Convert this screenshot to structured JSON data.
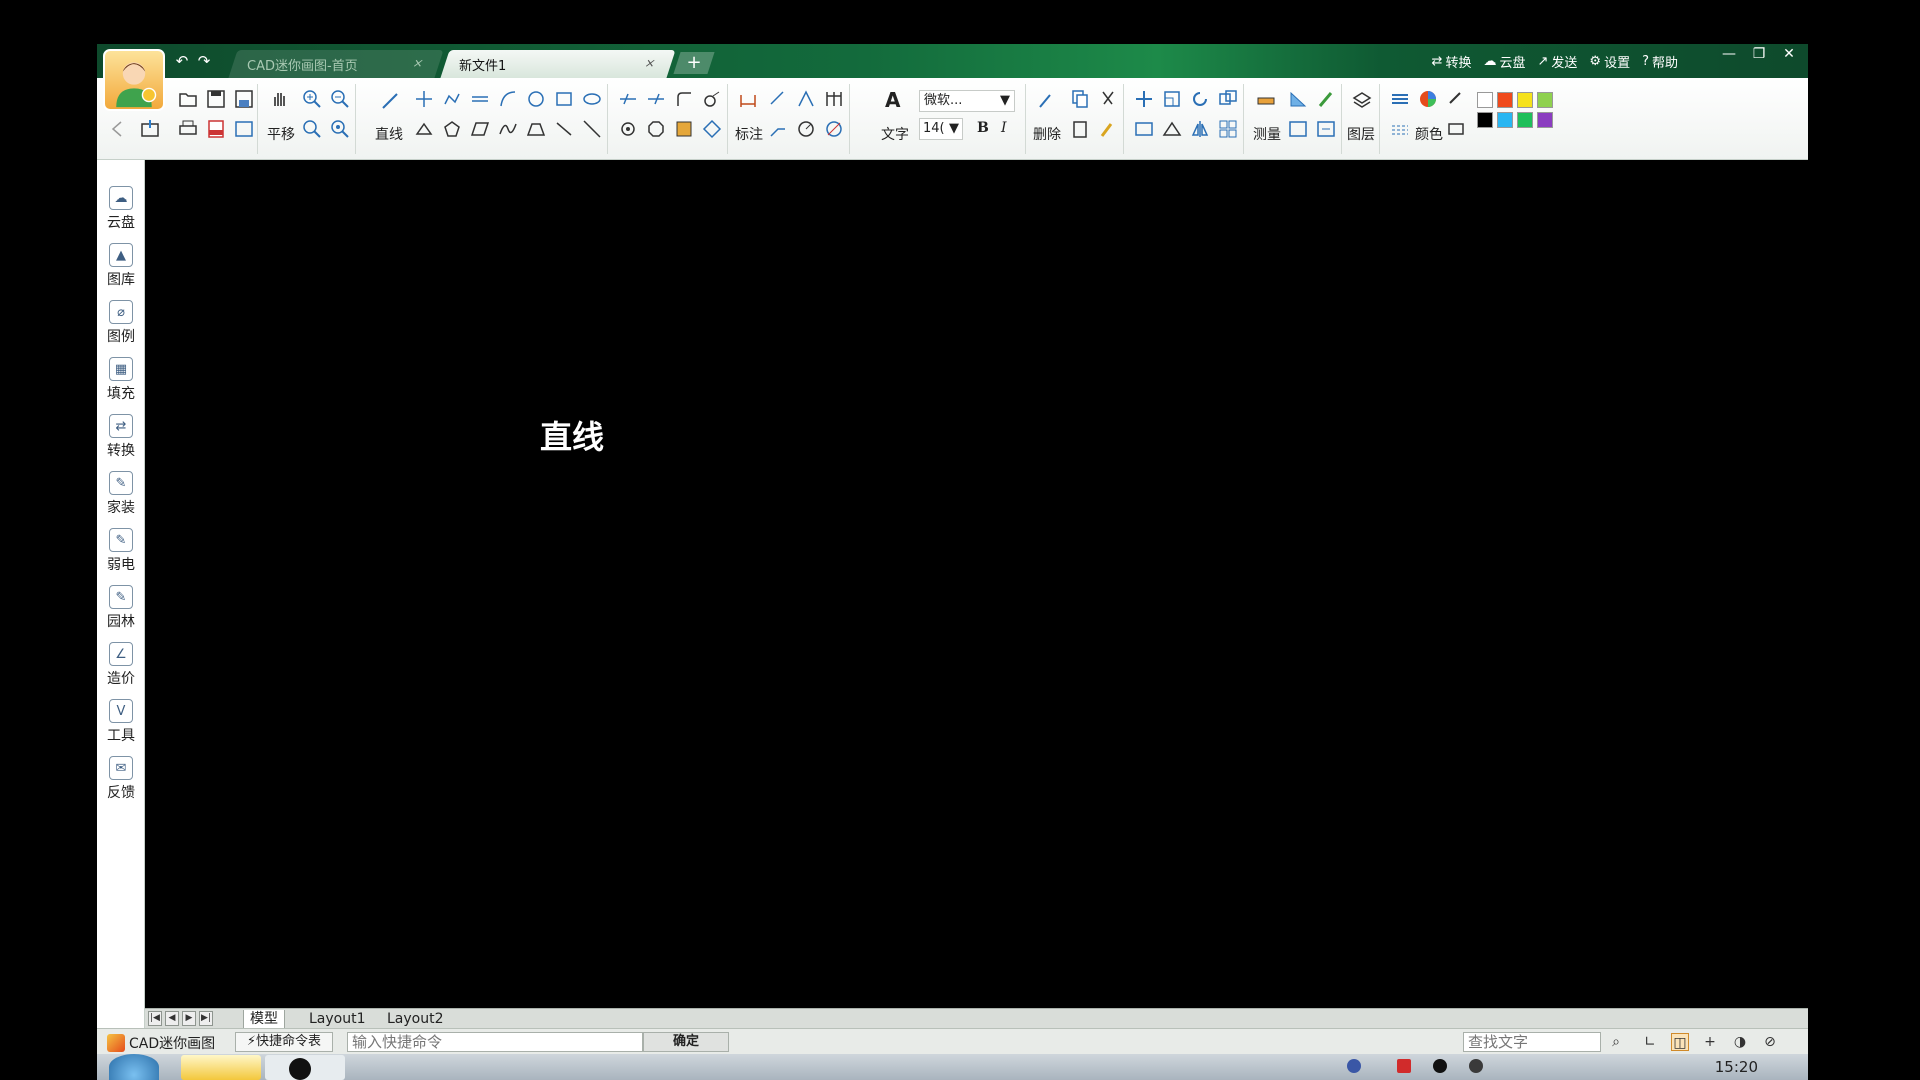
{
  "app": {
    "tabs": [
      {
        "label": "CAD迷你画图-首页",
        "close": "×"
      },
      {
        "label": "新文件1",
        "close": "×"
      }
    ],
    "add_tab": "+",
    "top_menu": [
      {
        "icon": "⇄",
        "label": "转换"
      },
      {
        "icon": "☁",
        "label": "云盘"
      },
      {
        "icon": "↗",
        "label": "发送"
      },
      {
        "icon": "⚙",
        "label": "设置"
      },
      {
        "icon": "?",
        "label": "帮助"
      }
    ],
    "window_controls": {
      "min": "—",
      "restore": "❐",
      "close": "✕"
    }
  },
  "ribbon": {
    "pan_label": "平移",
    "line_label": "直线",
    "dim_label": "标注",
    "text_label": "文字",
    "font_value": "微软...",
    "size_value": "14(",
    "bold": "B",
    "italic": "I",
    "text_icon": "A",
    "delete_label": "删除",
    "measure_label": "测量",
    "layer_label": "图层",
    "color_label": "颜色",
    "swatches": [
      "#ffffff",
      "#f04a1c",
      "#f5e21c",
      "#8fd14f",
      "#000000",
      "#29b6f2",
      "#1fbf5a",
      "#8b3dc0"
    ]
  },
  "sidebar": {
    "items": [
      {
        "label": "云盘",
        "icon": "cloud-icon"
      },
      {
        "label": "图库",
        "icon": "gallery-icon"
      },
      {
        "label": "图例",
        "icon": "legend-icon"
      },
      {
        "label": "填充",
        "icon": "hatch-icon"
      },
      {
        "label": "转换",
        "icon": "convert-icon"
      },
      {
        "label": "家装",
        "icon": "home-decor-icon"
      },
      {
        "label": "弱电",
        "icon": "low-voltage-icon"
      },
      {
        "label": "园林",
        "icon": "garden-icon"
      },
      {
        "label": "造价",
        "icon": "cost-icon"
      },
      {
        "label": "工具",
        "icon": "tools-icon"
      },
      {
        "label": "反馈",
        "icon": "feedback-icon"
      }
    ]
  },
  "canvas": {
    "command_tooltip": "直线",
    "background": "#000000"
  },
  "layout_tabs": [
    "模型",
    "Layout1",
    "Layout2"
  ],
  "status": {
    "app_name": "CAD迷你画图",
    "shortcut_button": "⚡快捷命令表",
    "command_placeholder": "输入快捷命令",
    "ok_button": "确定",
    "find_placeholder": "查找文字"
  },
  "taskbar": {
    "clock": "15:20"
  }
}
